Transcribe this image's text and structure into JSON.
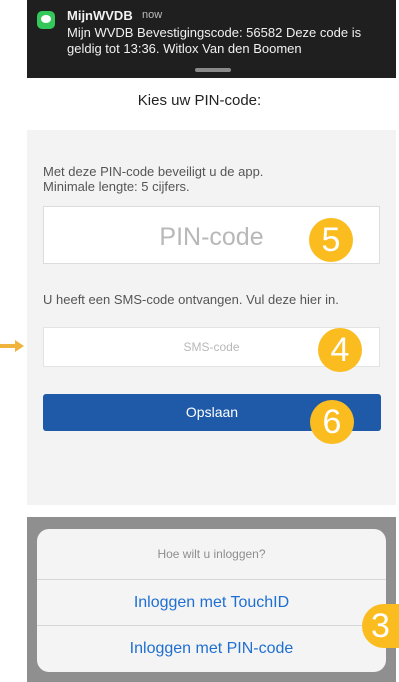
{
  "notification": {
    "app_name": "MijnWVDB",
    "time": "now",
    "message": "Mijn WVDB Bevestigingscode: 56582 Deze code is geldig tot 13:36. Witlox Van den Boomen",
    "icon": "messages-icon"
  },
  "page_title": "Kies uw PIN-code:",
  "form": {
    "intro_line1": "Met deze PIN-code beveiligt u de app.",
    "intro_line2": "Minimale lengte: 5 cijfers.",
    "pin_placeholder": "PIN-code",
    "sms_text": "U heeft een SMS-code ontvangen. Vul deze hier in.",
    "sms_placeholder": "SMS-code",
    "save_label": "Opslaan"
  },
  "badges": {
    "pin": "5",
    "sms": "4",
    "save": "6",
    "sheet": "3",
    "color": "#fbbc1f"
  },
  "action_sheet": {
    "title": "Hoe wilt u inloggen?",
    "option_touchid": "Inloggen met TouchID",
    "option_pin": "Inloggen met PIN-code"
  },
  "colors": {
    "primary_button": "#1f5aa8",
    "link": "#1f6fd1",
    "arrow": "#f0b43c"
  }
}
